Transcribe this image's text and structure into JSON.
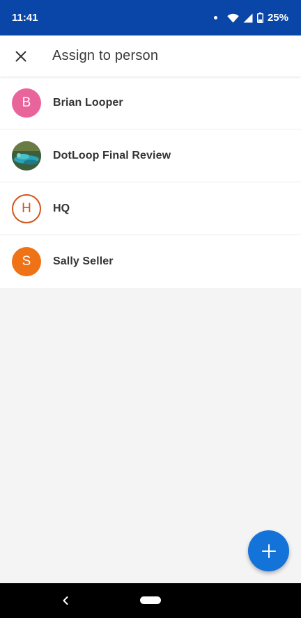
{
  "status_bar": {
    "time": "11:41",
    "battery": "25%"
  },
  "app_bar": {
    "title": "Assign to person",
    "close_icon": "close-icon"
  },
  "contacts": [
    {
      "name": "Brian Looper",
      "initial": "B",
      "avatar_color": "#e8649b",
      "avatar_style": "filled"
    },
    {
      "name": "DotLoop Final Review",
      "initial": "",
      "avatar_color": "#2f6a5a",
      "avatar_style": "photo"
    },
    {
      "name": "HQ",
      "initial": "H",
      "avatar_color": "#d2531a",
      "avatar_style": "outline"
    },
    {
      "name": "Sally Seller",
      "initial": "S",
      "avatar_color": "#f07216",
      "avatar_style": "filled"
    }
  ],
  "fab": {
    "icon": "plus-icon",
    "color": "#1473d8"
  },
  "colors": {
    "status_bar": "#0a46a8",
    "background": "#f4f4f4"
  }
}
